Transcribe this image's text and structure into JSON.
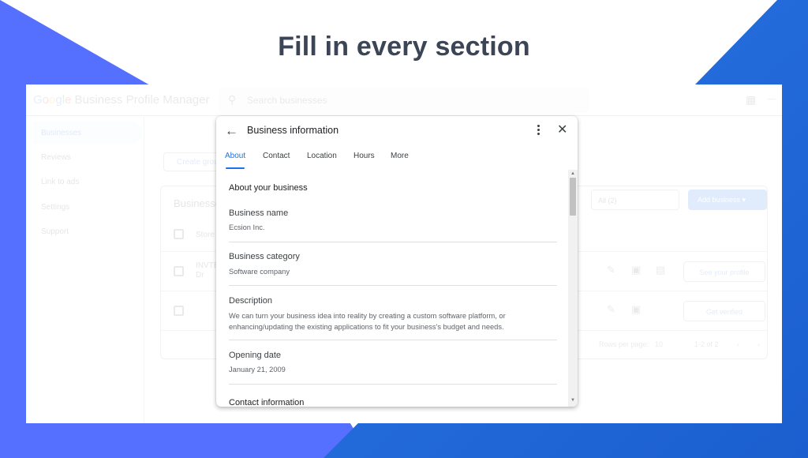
{
  "headline": "Fill in every section",
  "colors": {
    "left_shape": "#5570ff",
    "right_shape": "#1f6bdf",
    "headline": "#3b4556",
    "accent": "#1a73e8"
  },
  "app": {
    "brand_letters": [
      "G",
      "o",
      "o",
      "g",
      "l",
      "e"
    ],
    "brand_suffix": " Business Profile Manager",
    "search_placeholder": "Search businesses",
    "search_icon": "search-icon",
    "apps_icon": "apps-grid-icon"
  },
  "sidebar": {
    "items": [
      {
        "label": "Businesses",
        "active": true
      },
      {
        "label": "Reviews",
        "active": false
      },
      {
        "label": "Link to ads",
        "active": false
      },
      {
        "label": "Settings",
        "active": false
      },
      {
        "label": "Support",
        "active": false
      }
    ]
  },
  "businesses_panel": {
    "create_group_label": "Create group",
    "title": "Businesses",
    "filter_value": "All (2)",
    "add_business_label": "Add business ▾",
    "header_row_label": "Store c",
    "rows": [
      {
        "name_line1": "INVTE",
        "name_line2": "Dr",
        "button_label": "See your profile"
      },
      {
        "name_line1": "",
        "name_line2": "",
        "button_label": "Get verified"
      }
    ],
    "pager": {
      "rows_per_page_label": "Rows per page:",
      "rows_per_page_value": "10",
      "range": "1-2 of 2"
    }
  },
  "dialog": {
    "title": "Business information",
    "tabs": [
      {
        "label": "About",
        "active": true
      },
      {
        "label": "Contact",
        "active": false
      },
      {
        "label": "Location",
        "active": false
      },
      {
        "label": "Hours",
        "active": false
      },
      {
        "label": "More",
        "active": false
      }
    ],
    "section_heading": "About your business",
    "fields": [
      {
        "label": "Business name",
        "value": "Ecsion Inc."
      },
      {
        "label": "Business category",
        "value": "Software company"
      },
      {
        "label": "Description",
        "value": "We can turn your business idea into reality by creating a custom software platform, or enhancing/updating the existing applications to fit your business's budget and needs."
      },
      {
        "label": "Opening date",
        "value": "January 21, 2009"
      }
    ],
    "next_section_heading": "Contact information"
  }
}
